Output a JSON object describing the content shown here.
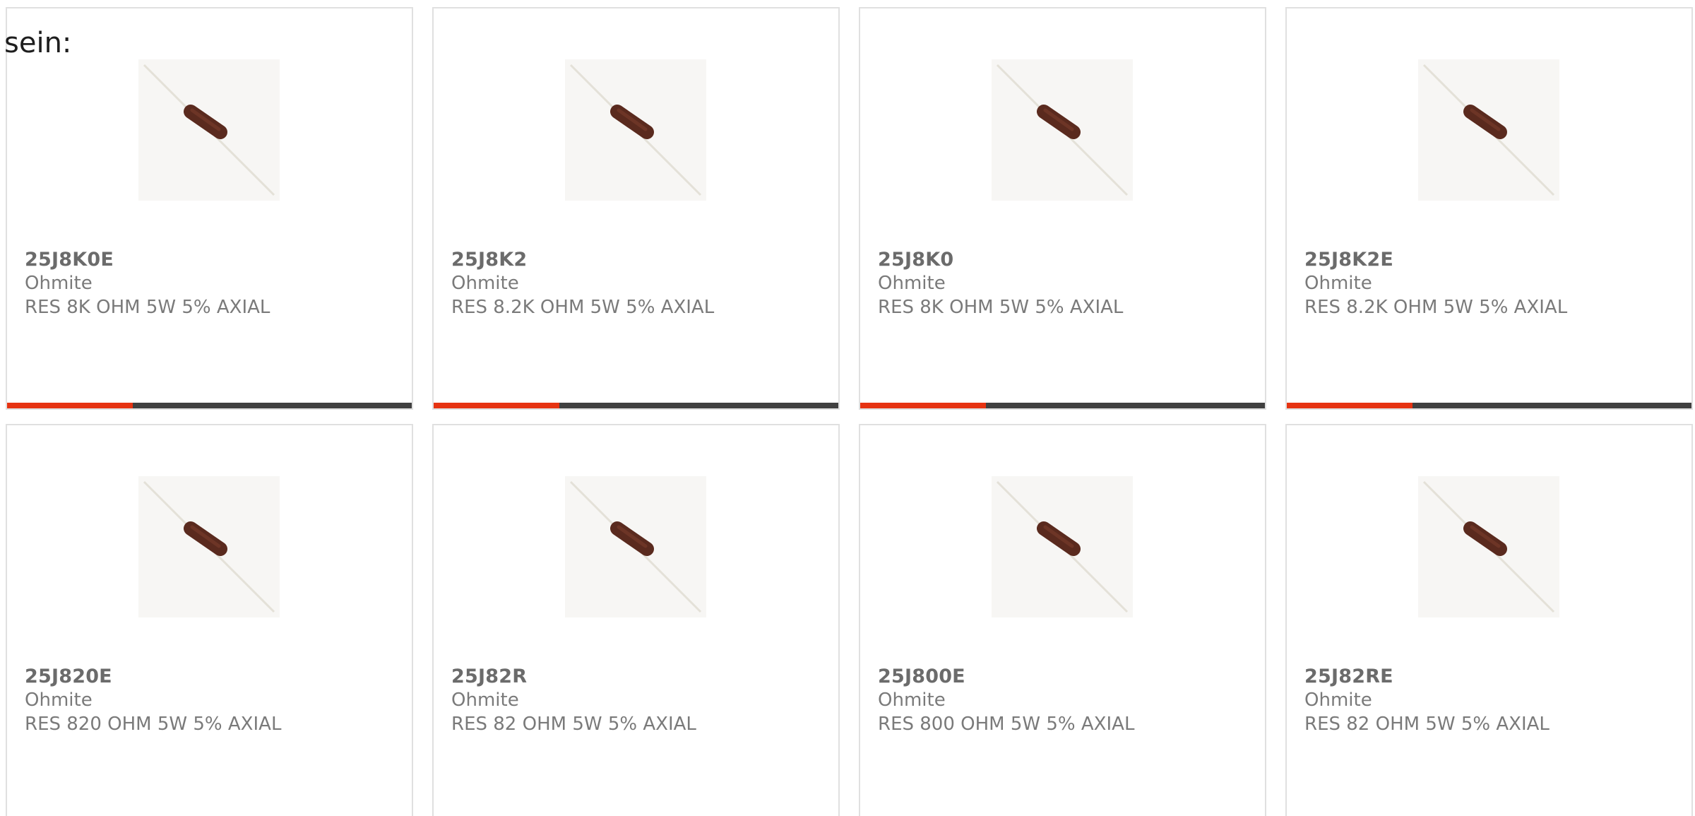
{
  "overlay_text": "sein:",
  "colors": {
    "accent": "#e63312",
    "bar_track": "#404040",
    "card_border": "#e0e0e0",
    "text": "#7a7a7a"
  },
  "cards": [
    {
      "part": "25J8K0E",
      "manufacturer": "Ohmite",
      "description": "RES 8K OHM 5W 5% AXIAL",
      "image_icon": "resistor-image",
      "progress": 0.31
    },
    {
      "part": "25J8K2",
      "manufacturer": "Ohmite",
      "description": "RES 8.2K OHM 5W 5% AXIAL",
      "image_icon": "resistor-image",
      "progress": 0.31
    },
    {
      "part": "25J8K0",
      "manufacturer": "Ohmite",
      "description": "RES 8K OHM 5W 5% AXIAL",
      "image_icon": "resistor-image",
      "progress": 0.31
    },
    {
      "part": "25J8K2E",
      "manufacturer": "Ohmite",
      "description": "RES 8.2K OHM 5W 5% AXIAL",
      "image_icon": "resistor-image",
      "progress": 0.31
    },
    {
      "part": "25J820E",
      "manufacturer": "Ohmite",
      "description": "RES 820 OHM 5W 5% AXIAL",
      "image_icon": "resistor-image"
    },
    {
      "part": "25J82R",
      "manufacturer": "Ohmite",
      "description": "RES 82 OHM 5W 5% AXIAL",
      "image_icon": "resistor-image"
    },
    {
      "part": "25J800E",
      "manufacturer": "Ohmite",
      "description": "RES 800 OHM 5W 5% AXIAL",
      "image_icon": "resistor-image"
    },
    {
      "part": "25J82RE",
      "manufacturer": "Ohmite",
      "description": "RES 82 OHM 5W 5% AXIAL",
      "image_icon": "resistor-image"
    }
  ]
}
